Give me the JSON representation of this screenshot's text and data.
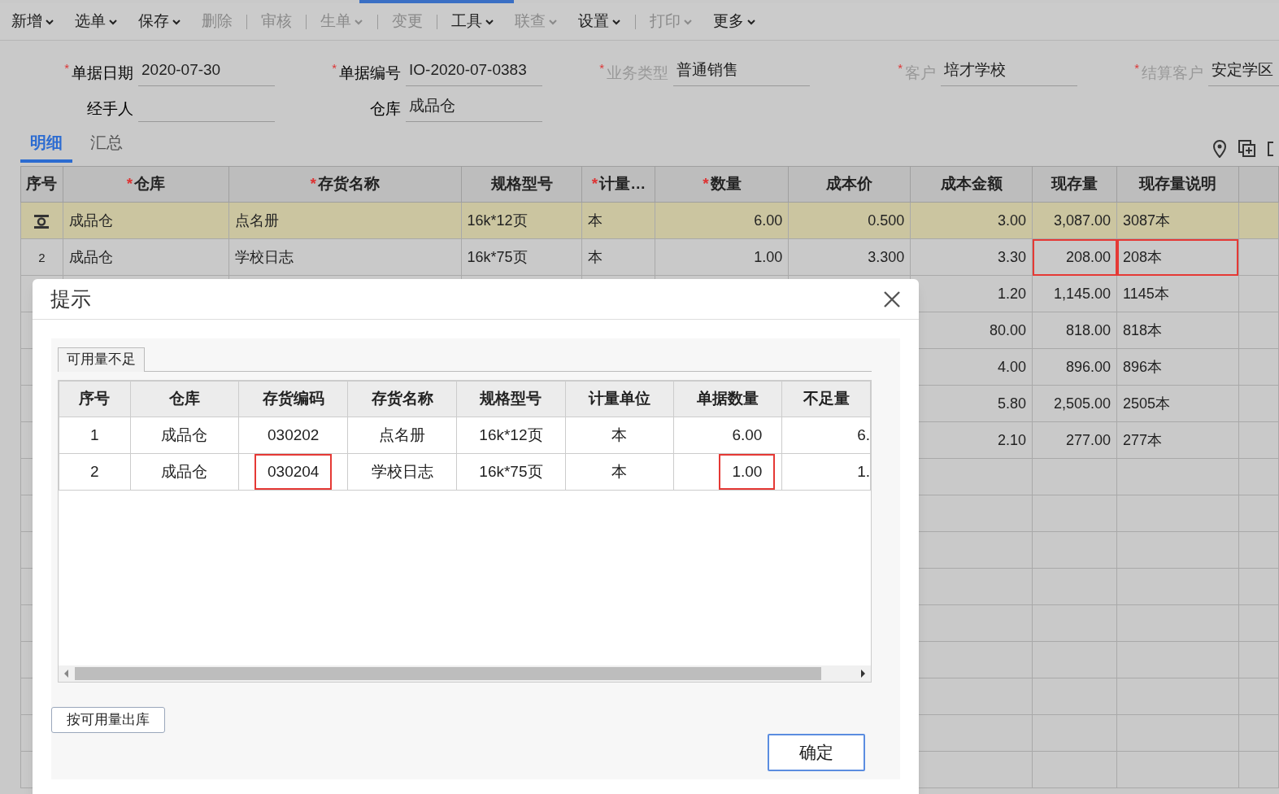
{
  "toolbar": [
    {
      "label": "新增",
      "disabled": false,
      "dropdown": true,
      "divider_after": false
    },
    {
      "label": "选单",
      "disabled": false,
      "dropdown": true,
      "divider_after": false
    },
    {
      "label": "保存",
      "disabled": false,
      "dropdown": true,
      "divider_after": false
    },
    {
      "label": "删除",
      "disabled": true,
      "dropdown": false,
      "divider_after": true
    },
    {
      "label": "审核",
      "disabled": true,
      "dropdown": false,
      "divider_after": true
    },
    {
      "label": "生单",
      "disabled": true,
      "dropdown": true,
      "divider_after": true
    },
    {
      "label": "变更",
      "disabled": true,
      "dropdown": false,
      "divider_after": true
    },
    {
      "label": "工具",
      "disabled": false,
      "dropdown": true,
      "divider_after": false
    },
    {
      "label": "联查",
      "disabled": true,
      "dropdown": true,
      "divider_after": false
    },
    {
      "label": "设置",
      "disabled": false,
      "dropdown": true,
      "divider_after": true
    },
    {
      "label": "打印",
      "disabled": true,
      "dropdown": true,
      "divider_after": false
    },
    {
      "label": "更多",
      "disabled": false,
      "dropdown": true,
      "divider_after": false
    }
  ],
  "form": [
    [
      {
        "required_mark": "*",
        "label": "单据日期",
        "disabled": false,
        "value": "2020-07-30"
      },
      {
        "required_mark": "*",
        "label": "单据编号",
        "disabled": false,
        "value": "IO-2020-07-0383"
      },
      {
        "required_mark": "*",
        "label": "业务类型",
        "disabled": true,
        "value": "普通销售"
      },
      {
        "required_mark": "*",
        "label": "客户",
        "disabled": true,
        "value": "培才学校"
      },
      {
        "required_mark": "*",
        "label": "结算客户",
        "disabled": true,
        "value": "安定学区"
      }
    ],
    [
      {
        "label": "经手人",
        "disabled": false
      },
      {
        "label": "仓库",
        "disabled": false,
        "value": "成品仓"
      }
    ]
  ],
  "tabs": [
    {
      "label": "明细",
      "selected": true
    },
    {
      "label": "汇总",
      "selected": false
    }
  ],
  "table": {
    "columns": [
      {
        "label": "序号"
      },
      {
        "required_mark": "*",
        "label": "仓库"
      },
      {
        "required_mark": "*",
        "label": "存货名称"
      },
      {
        "label": "规格型号"
      },
      {
        "required_mark": "*",
        "label": "计量…"
      },
      {
        "required_mark": "*",
        "label": "数量"
      },
      {
        "label": "成本价"
      },
      {
        "label": "成本金额"
      },
      {
        "label": "现存量"
      },
      {
        "label": "现存量说明"
      }
    ],
    "rows": [
      {
        "selected": true,
        "cells": [
          null,
          "成品仓",
          "点名册",
          "16k*12页",
          "本",
          "6.00",
          "0.500",
          "3.00",
          "3,087.00",
          "3087本"
        ]
      },
      {
        "selected": false,
        "cells": [
          "2",
          "成品仓",
          "学校日志",
          "16k*75页",
          "本",
          "1.00",
          "3.300",
          "3.30",
          {
            "text": "208.00",
            "highlighted": true
          },
          {
            "text": "208本",
            "highlighted": true
          }
        ]
      },
      {
        "selected": false,
        "cells": [
          null,
          null,
          null,
          null,
          null,
          null,
          null,
          "1.20",
          "1,145.00",
          "1145本"
        ]
      },
      {
        "selected": false,
        "cells": [
          null,
          null,
          null,
          null,
          null,
          null,
          null,
          "80.00",
          "818.00",
          "818本"
        ]
      },
      {
        "selected": false,
        "cells": [
          null,
          null,
          null,
          null,
          null,
          null,
          null,
          "4.00",
          "896.00",
          "896本"
        ]
      },
      {
        "selected": false,
        "cells": [
          null,
          null,
          null,
          null,
          null,
          null,
          null,
          "5.80",
          "2,505.00",
          "2505本"
        ]
      },
      {
        "selected": false,
        "cells": [
          null,
          null,
          null,
          null,
          null,
          null,
          null,
          "2.10",
          "277.00",
          "277本"
        ]
      }
    ]
  },
  "dialog": {
    "title": "提示",
    "tab": "可用量不足",
    "columns": [
      "序号",
      "仓库",
      "存货编码",
      "存货名称",
      "规格型号",
      "计量单位",
      "单据数量",
      "不足量"
    ],
    "rows": [
      {
        "cells": [
          "1",
          "成品仓",
          "030202",
          "点名册",
          "16k*12页",
          "本",
          "6.00",
          "6."
        ]
      },
      {
        "cells": [
          "2",
          "成品仓",
          {
            "text": "030204",
            "highlighted": true
          },
          "学校日志",
          "16k*75页",
          "本",
          {
            "text": "1.00",
            "highlighted": true
          },
          "1."
        ]
      }
    ],
    "buttons": [
      {
        "label": "按可用量出库",
        "kind": "secondary"
      },
      {
        "label": "确定",
        "kind": "primary"
      }
    ]
  }
}
